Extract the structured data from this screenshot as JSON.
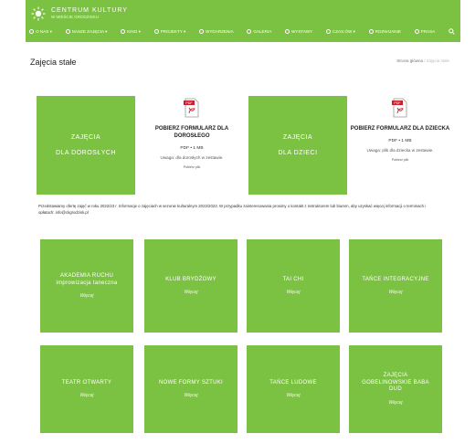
{
  "header": {
    "logo_title": "CENTRUM KULTURY",
    "logo_sub": "W MIEŚCIE GRODZISKU",
    "nav": [
      {
        "label": "O NAS ▾"
      },
      {
        "label": "NASZE ZAJĘCIA ▾"
      },
      {
        "label": "KINO ▾"
      },
      {
        "label": "PROJEKTY ▾"
      },
      {
        "label": "WYDARZENIA"
      },
      {
        "label": "GALERIA"
      },
      {
        "label": "WYSTAWY"
      },
      {
        "label": "CZAS.ÓW ▾"
      },
      {
        "label": "ROZWIJANIE"
      },
      {
        "label": "PRASA"
      }
    ],
    "search_icon": "search-icon"
  },
  "page": {
    "title": "Zajęcia stałe",
    "breadcrumb_home": "Strona główna",
    "breadcrumb_current": "/ Zajęcia stałe"
  },
  "big_tiles": [
    {
      "line1": "ZAJĘCIA",
      "line2": "DLA DOROSŁYCH"
    },
    {
      "line1": "ZAJĘCIA",
      "line2": "DLA DZIECI"
    }
  ],
  "forms": [
    {
      "title": "POBIERZ FORMULARZ DLA DOROSŁEGO",
      "size": "PDF • 1 MB",
      "note": "Uwaga: dla dorosłych w zestawie.",
      "link": "Pobierz plik"
    },
    {
      "title": "POBIERZ FORMULARZ DLA DZIECKA",
      "size": "PDF • 1 MB",
      "note": "Uwaga: plik dla dziecka w zestawie.",
      "link": "Pobierz plik"
    }
  ],
  "info_text": "Przedstawiamy ofertę zajęć w roku 2022/23 r. Informacje o zajęciach w sezonie kulturalnym 2022/2023. W przypadku zainteresowania prosimy o kontakt z instruktorem lub biurem, aby uzyskać więcej informacji o terminach i opłatach: info@ckgrodzisk.pl",
  "activities": [
    {
      "title": "AKADEMIA RUCHU improwizacja taneczna",
      "more": "Więcej"
    },
    {
      "title": "KLUB BRYDŻOWY",
      "more": "Więcej"
    },
    {
      "title": "TAI CHI",
      "more": "Więcej"
    },
    {
      "title": "TAŃCE INTEGRACYJNE",
      "more": "Więcej"
    },
    {
      "title": "TEATR OTWARTY",
      "more": "Więcej"
    },
    {
      "title": "NOWE FORMY SZTUKI",
      "more": "Więcej"
    },
    {
      "title": "TAŃCE LUDOWE",
      "more": "Więcej"
    },
    {
      "title": "ZAJĘCIA GOBELINOWSKIE BABA DUD",
      "more": "Więcej"
    }
  ],
  "colors": {
    "brand_green": "#7cc242",
    "pdf_red": "#c8202a"
  }
}
